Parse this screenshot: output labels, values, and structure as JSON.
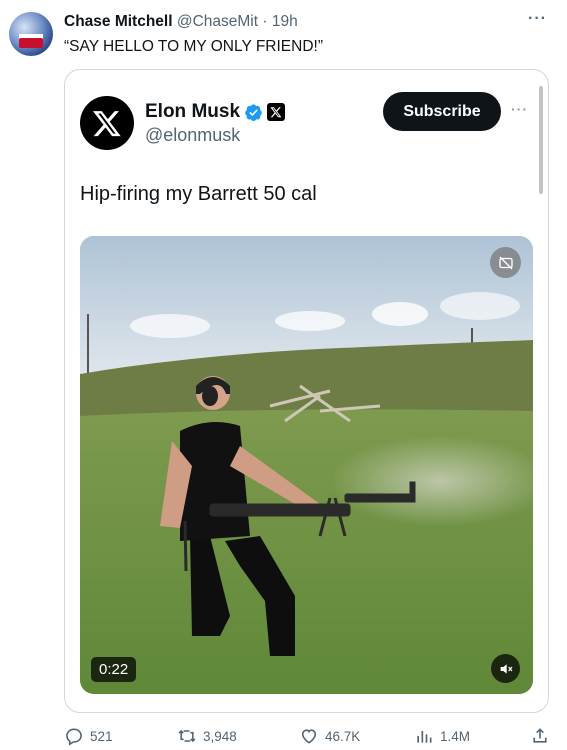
{
  "post": {
    "author_name": "Chase Mitchell",
    "author_handle": "@ChaseMit",
    "separator": "·",
    "time": "19h",
    "text": "“SAY HELLO TO MY ONLY FRIEND!”",
    "more_icon": "ellipsis-icon"
  },
  "quoted": {
    "author_name": "Elon Musk",
    "author_handle": "@elonmusk",
    "subscribe_label": "Subscribe",
    "text": "Hip-firing my Barrett 50 cal",
    "media": {
      "duration": "0:22",
      "gif_icon": "hide-media-icon",
      "mute_icon": "speaker-muted-icon"
    }
  },
  "actions": {
    "replies": "521",
    "reposts": "3,948",
    "likes": "46.7K",
    "views": "1.4M"
  },
  "colors": {
    "text": "#0f1419",
    "muted": "#536471",
    "border": "#cfd9de",
    "verified": "#1d9bf0",
    "button_bg": "#0f1419"
  }
}
